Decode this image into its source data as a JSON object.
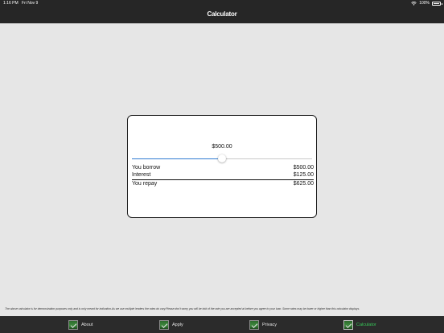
{
  "status_bar": {
    "time": "1:16 PM",
    "date": "Fri Nov 9",
    "battery_percent": "100%",
    "battery_level": 1.0,
    "wifi_icon": "wifi-icon"
  },
  "nav": {
    "title": "Calculator"
  },
  "calculator": {
    "amount_display": "$500.00",
    "slider_fraction": 0.5,
    "slider_accent": "#2f7bd1",
    "rows": [
      {
        "label": "You borrow",
        "value": "$500.00"
      },
      {
        "label": "Interest",
        "value": "$125.00"
      }
    ],
    "total": {
      "label": "You repay",
      "value": "$625.00"
    }
  },
  "disclaimer": "The above calculator is for demonstration purposes only and is only meant for indication.As we use multiple lenders the rates do vary.Please don't worry you will be told of the rate you are accepted at before you agree to your loan. Some rates may be lower or higher than this calculator displays.",
  "tabbar": {
    "active_color": "#39c95a",
    "tabs": [
      {
        "label": "About",
        "icon": "checkmark-icon",
        "active": false
      },
      {
        "label": "Apply",
        "icon": "checkmark-icon",
        "active": false
      },
      {
        "label": "Privacy",
        "icon": "checkmark-icon",
        "active": false
      },
      {
        "label": "Calculator",
        "icon": "checkmark-icon",
        "active": true
      }
    ]
  }
}
